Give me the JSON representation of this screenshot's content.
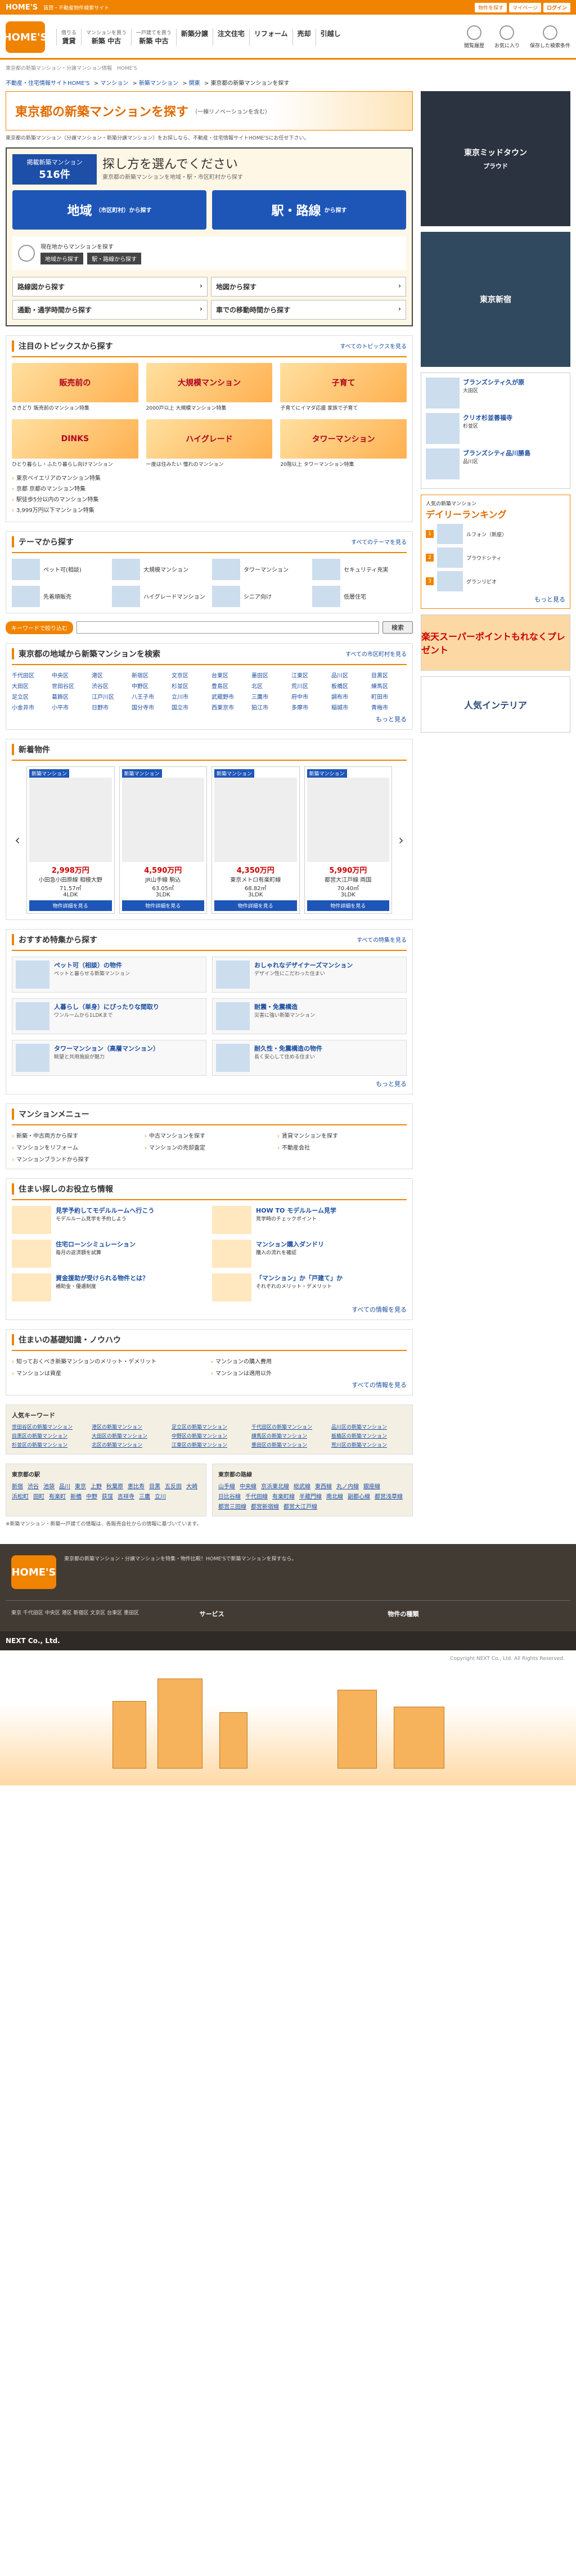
{
  "topbar": {
    "logo": "HOME'S",
    "tagline": "賃貸・不動産物件検索サイト",
    "links": [
      "物件を探す",
      "マイページ",
      "ログイン"
    ]
  },
  "header": {
    "logo": "HOME'S",
    "nav": [
      {
        "sub": "借りる",
        "label": "賃貸"
      },
      {
        "sub": "マンションを買う",
        "label": "新築 中古"
      },
      {
        "sub": "一戸建てを買う",
        "label": "新築 中古"
      },
      {
        "sub": "",
        "label": "新築分譲"
      },
      {
        "sub": "",
        "label": "注文住宅"
      },
      {
        "sub": "",
        "label": "リフォーム"
      },
      {
        "sub": "",
        "label": "売却"
      },
      {
        "sub": "",
        "label": "引越し"
      }
    ],
    "icons": [
      "閲覧履歴",
      "お気に入り",
      "保存した検索条件"
    ]
  },
  "crumb": "東京都の新築マンション・分譲マンション情報　HOME'S",
  "breadcrumb": [
    "不動産・住宅情報サイトHOME'S",
    "マンション",
    "新築マンション",
    "関東",
    "東京都の新築マンションを探す"
  ],
  "title": {
    "main": "東京都の新築マンションを探す",
    "note": "（一棟リノベーションを含む）"
  },
  "intro": "東京都の新築マンション（分譲マンション・新築分譲マンション）をお探しなら、不動産・住宅情報サイトHOME'Sにお任せ下さい。",
  "search": {
    "count_label": "掲載新築マンション",
    "count": "516件",
    "title": "探し方を選んでください",
    "sub": "東京都の新築マンションを地域・駅・市区町村から探す",
    "btn_area": "地域",
    "btn_area_sub": "（市区町村）から探す",
    "btn_station": "駅・路線",
    "btn_station_sub": "から探す",
    "loc_text": "現在地からマンションを探す",
    "loc_btns": [
      "地域から探す",
      "駅・路線から探す"
    ],
    "options": [
      "路線図から探す",
      "地図から探す",
      "通勤・通学時間から探す",
      "車での移動時間から探す"
    ]
  },
  "topics": {
    "title": "注目のトピックスから探す",
    "more": "すべてのトピックスを見る",
    "items": [
      {
        "img": "販売前の",
        "cap": "さきどり 販売前のマンション特集"
      },
      {
        "img": "大規模マンション",
        "cap": "2000戸以上 大規模マンション特集"
      },
      {
        "img": "子育て",
        "cap": "子育てにイマダ応援 家族で子育て"
      },
      {
        "img": "DINKS",
        "cap": "ひとり暮らし・ふたり暮らし向けマンション"
      },
      {
        "img": "ハイグレード",
        "cap": "一度は住みたい 憧れのマンション"
      },
      {
        "img": "タワーマンション",
        "cap": "20階以上 タワーマンション特集"
      }
    ],
    "links": [
      "東京ベイエリアのマンション特集",
      "京都 京都のマンション特集",
      "駅徒歩5分以内のマンション特集",
      "3,999万円以下マンション特集"
    ]
  },
  "theme": {
    "title": "テーマから探す",
    "more": "すべてのテーマを見る",
    "items": [
      "ペット可(相談)",
      "大規模マンション",
      "タワーマンション",
      "セキュリティ充実",
      "先着順販売",
      "ハイグレードマンション",
      "シニア向け",
      "低層住宅"
    ]
  },
  "keyword": {
    "label": "キーワードで絞り込む",
    "placeholder": "",
    "button": "検索"
  },
  "area": {
    "title": "東京都の地域から新築マンションを検索",
    "more": "すべての市区町村を見る",
    "list": [
      "千代田区",
      "中央区",
      "港区",
      "新宿区",
      "文京区",
      "台東区",
      "墨田区",
      "江東区",
      "品川区",
      "目黒区",
      "大田区",
      "世田谷区",
      "渋谷区",
      "中野区",
      "杉並区",
      "豊島区",
      "北区",
      "荒川区",
      "板橋区",
      "練馬区",
      "足立区",
      "葛飾区",
      "江戸川区",
      "八王子市",
      "立川市",
      "武蔵野市",
      "三鷹市",
      "府中市",
      "調布市",
      "町田市",
      "小金井市",
      "小平市",
      "日野市",
      "国分寺市",
      "国立市",
      "西東京市",
      "狛江市",
      "多摩市",
      "稲城市",
      "青梅市"
    ],
    "more2": "もっと見る"
  },
  "newProps": {
    "title": "新着物件",
    "items": [
      {
        "tag": "新築マンション",
        "price": "2,998万円",
        "name": "小田急小田原線 相模大野",
        "size": "71.57㎡",
        "plan": "4LDK"
      },
      {
        "tag": "新築マンション",
        "price": "4,590万円",
        "name": "JR山手線 駒込",
        "size": "63.05㎡",
        "plan": "3LDK"
      },
      {
        "tag": "新築マンション",
        "price": "4,350万円",
        "name": "東京メトロ有楽町線",
        "size": "68.82㎡",
        "plan": "3LDK"
      },
      {
        "tag": "新築マンション",
        "price": "5,990万円",
        "name": "都営大江戸線 両国",
        "size": "70.40㎡",
        "plan": "3LDK"
      }
    ],
    "btn": "物件詳細を見る"
  },
  "recommend": {
    "title": "おすすめ特集から探す",
    "more": "すべての特集を見る",
    "items": [
      {
        "t": "ペット可（相談）の物件",
        "d": "ペットと暮らせる新築マンション"
      },
      {
        "t": "おしゃれなデザイナーズマンション",
        "d": "デザイン性にこだわった住まい"
      },
      {
        "t": "人暮らし（単身）にぴったりな間取り",
        "d": "ワンルームから1LDKまで"
      },
      {
        "t": "耐震・免震構造",
        "d": "災害に強い新築マンション"
      },
      {
        "t": "タワーマンション（高層マンション）",
        "d": "眺望と共用施設が魅力"
      },
      {
        "t": "耐久性・免震構造の物件",
        "d": "長く安心して住める住まい"
      }
    ],
    "more2": "もっと見る"
  },
  "menu": {
    "title": "マンションメニュー",
    "items": [
      "新築・中古両方から探す",
      "中古マンションを探す",
      "賃貸マンションを探す",
      "マンションをリフォーム",
      "マンションの売却査定",
      "不動産会社",
      "マンションブランドから探す"
    ]
  },
  "help": {
    "title": "住まい探しのお役立ち情報",
    "items": [
      {
        "t": "見学予約してモデルルームへ行こう",
        "d": "モデルルーム見学を予約しよう"
      },
      {
        "t": "HOW TO モデルルーム見学",
        "d": "見学時のチェックポイント"
      },
      {
        "t": "住宅ローンシミュレーション",
        "d": "毎月の返済額を試算"
      },
      {
        "t": "マンション購入ダンドリ",
        "d": "購入の流れを確認"
      },
      {
        "t": "資金援助が受けられる物件とは？",
        "d": "補助金・優遇制度"
      },
      {
        "t": "「マンション」か「戸建て」か",
        "d": "それぞれのメリット・デメリット"
      }
    ],
    "more": "すべての情報を見る"
  },
  "basics": {
    "title": "住まいの基礎知識・ノウハウ",
    "items": [
      "知っておくべき新築マンションのメリット・デメリット",
      "マンションの購入費用",
      "マンションは資産",
      "マンションは適用以外"
    ],
    "more": "すべての情報を見る"
  },
  "keywords": {
    "title": "人気キーワード",
    "list": [
      "世田谷区の新築マンション",
      "港区の新築マンション",
      "足立区の新築マンション",
      "千代田区の新築マンション",
      "品川区の新築マンション",
      "目黒区の新築マンション",
      "大田区の新築マンション",
      "中野区の新築マンション",
      "練馬区の新築マンション",
      "板橋区の新築マンション",
      "杉並区の新築マンション",
      "北区の新築マンション",
      "江東区の新築マンション",
      "墨田区の新築マンション",
      "荒川区の新築マンション"
    ]
  },
  "stations": {
    "t1": "東京都の駅",
    "s1": [
      "新宿",
      "渋谷",
      "池袋",
      "品川",
      "東京",
      "上野",
      "秋葉原",
      "恵比寿",
      "目黒",
      "五反田",
      "大崎",
      "浜松町",
      "田町",
      "有楽町",
      "新橋",
      "中野",
      "荻窪",
      "吉祥寺",
      "三鷹",
      "立川"
    ],
    "t2": "東京都の路線",
    "s2": [
      "山手線",
      "中央線",
      "京浜東北線",
      "総武線",
      "東西線",
      "丸ノ内線",
      "銀座線",
      "日比谷線",
      "千代田線",
      "有楽町線",
      "半蔵門線",
      "南北線",
      "副都心線",
      "都営浅草線",
      "都営三田線",
      "都営新宿線",
      "都営大江戸線"
    ]
  },
  "note": "※新築マンション・新築一戸建ての情報は、各販売会社からの情報に基づいています。",
  "side": {
    "ad1": "東京ミッドタウン",
    "ad1sub": "プラウド",
    "ad2": "東京新宿",
    "items": [
      {
        "t": "ブランズシティ久が原",
        "d": "大田区"
      },
      {
        "t": "クリオ杉並善福寺",
        "d": "杉並区"
      },
      {
        "t": "ブランズシティ品川勝島",
        "d": "品川区"
      }
    ],
    "rank_label": "人気の新築マンション",
    "rank_title": "デイリーランキング",
    "rank_more": "もっと見る",
    "rank": [
      {
        "n": "1",
        "t": "ルフォン（新座）"
      },
      {
        "n": "2",
        "t": "プラウドシティ"
      },
      {
        "n": "3",
        "t": "グランリビオ"
      }
    ],
    "promo1": "楽天スーパーポイントもれなくプレゼント",
    "promo2": "人気インテリア"
  },
  "footer": {
    "logo": "HOME'S",
    "desc": "東京都の新築マンション・分譲マンションを特集・物件比較！HOME'Sで新築マンションを探すなら。",
    "links_col1": "東京 千代田区 中央区 港区 新宿区 文京区 台東区 墨田区",
    "links_col2": "サービス",
    "links_col3": "物件の種類",
    "company": "NEXT Co., Ltd.",
    "copyright": "Copyright NEXT Co., Ltd. All Rights Reserved."
  }
}
